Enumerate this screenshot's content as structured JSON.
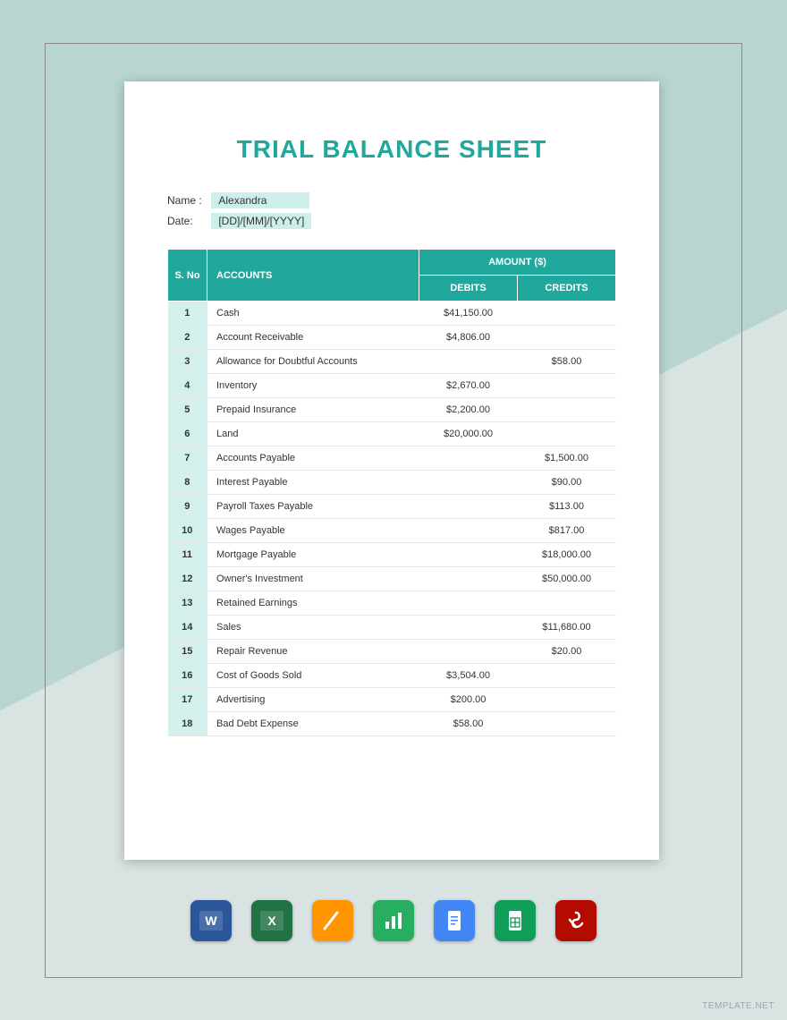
{
  "title": "TRIAL BALANCE SHEET",
  "meta": {
    "name_label": "Name :",
    "name_value": "Alexandra",
    "date_label": "Date:",
    "date_value": "[DD]/[MM]/[YYYY]"
  },
  "headers": {
    "sno": "S. No",
    "accounts": "ACCOUNTS",
    "amount": "AMOUNT ($)",
    "debits": "DEBITS",
    "credits": "CREDITS"
  },
  "rows": [
    {
      "n": "1",
      "account": "Cash",
      "debit": "$41,150.00",
      "credit": ""
    },
    {
      "n": "2",
      "account": "Account Receivable",
      "debit": "$4,806.00",
      "credit": ""
    },
    {
      "n": "3",
      "account": "Allowance for Doubtful Accounts",
      "debit": "",
      "credit": "$58.00"
    },
    {
      "n": "4",
      "account": "Inventory",
      "debit": "$2,670.00",
      "credit": ""
    },
    {
      "n": "5",
      "account": "Prepaid Insurance",
      "debit": "$2,200.00",
      "credit": ""
    },
    {
      "n": "6",
      "account": "Land",
      "debit": "$20,000.00",
      "credit": ""
    },
    {
      "n": "7",
      "account": "Accounts Payable",
      "debit": "",
      "credit": "$1,500.00"
    },
    {
      "n": "8",
      "account": "Interest Payable",
      "debit": "",
      "credit": "$90.00"
    },
    {
      "n": "9",
      "account": "Payroll Taxes Payable",
      "debit": "",
      "credit": "$113.00"
    },
    {
      "n": "10",
      "account": "Wages Payable",
      "debit": "",
      "credit": "$817.00"
    },
    {
      "n": "11",
      "account": "Mortgage Payable",
      "debit": "",
      "credit": "$18,000.00"
    },
    {
      "n": "12",
      "account": "Owner's Investment",
      "debit": "",
      "credit": "$50,000.00"
    },
    {
      "n": "13",
      "account": "Retained Earnings",
      "debit": "",
      "credit": ""
    },
    {
      "n": "14",
      "account": "Sales",
      "debit": "",
      "credit": "$11,680.00"
    },
    {
      "n": "15",
      "account": "Repair Revenue",
      "debit": "",
      "credit": "$20.00"
    },
    {
      "n": "16",
      "account": "Cost of Goods Sold",
      "debit": "$3,504.00",
      "credit": ""
    },
    {
      "n": "17",
      "account": "Advertising",
      "debit": "$200.00",
      "credit": ""
    },
    {
      "n": "18",
      "account": "Bad Debt Expense",
      "debit": "$58.00",
      "credit": ""
    }
  ],
  "apps": [
    {
      "name": "word-icon",
      "bg": "#2b579a"
    },
    {
      "name": "excel-icon",
      "bg": "#217346"
    },
    {
      "name": "pages-icon",
      "bg": "#ff9500"
    },
    {
      "name": "numbers-icon",
      "bg": "#27ae60"
    },
    {
      "name": "google-docs-icon",
      "bg": "#4285f4"
    },
    {
      "name": "google-sheets-icon",
      "bg": "#0f9d58"
    },
    {
      "name": "pdf-icon",
      "bg": "#b30b00"
    }
  ],
  "watermark": "TEMPLATE.NET"
}
